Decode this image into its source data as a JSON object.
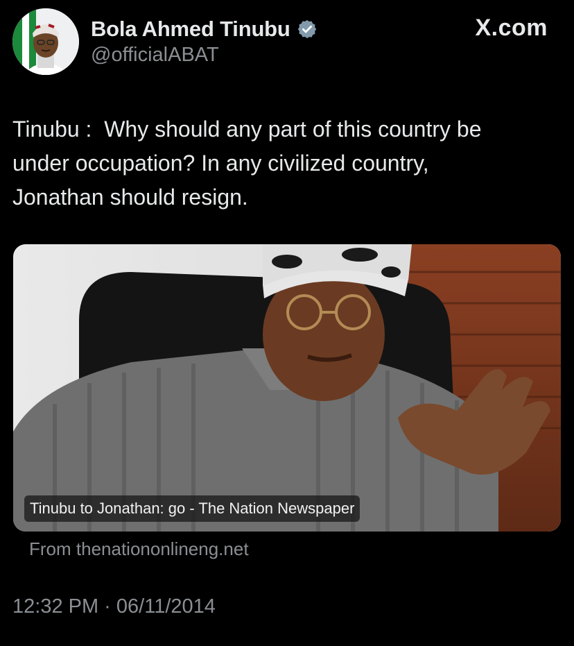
{
  "author": {
    "name": "Bola Ahmed Tinubu",
    "handle": "@officialABAT",
    "verified_icon": "verified-badge-icon",
    "avatar_icon": "profile-avatar"
  },
  "brand": "X.com",
  "tweet": {
    "text": "Tinubu :  Why should any part of this country be\nunder occupation? In any civilized country,\nJonathan should resign."
  },
  "link_card": {
    "caption": "Tinubu to Jonathan: go - The Nation Newspaper",
    "source": "From thenationonlineng.net"
  },
  "timestamp": "12:32 PM · 06/11/2014",
  "colors": {
    "background": "#000000",
    "text": "#e7e9ea",
    "muted": "#8b8f94",
    "verified": "#829aab"
  }
}
